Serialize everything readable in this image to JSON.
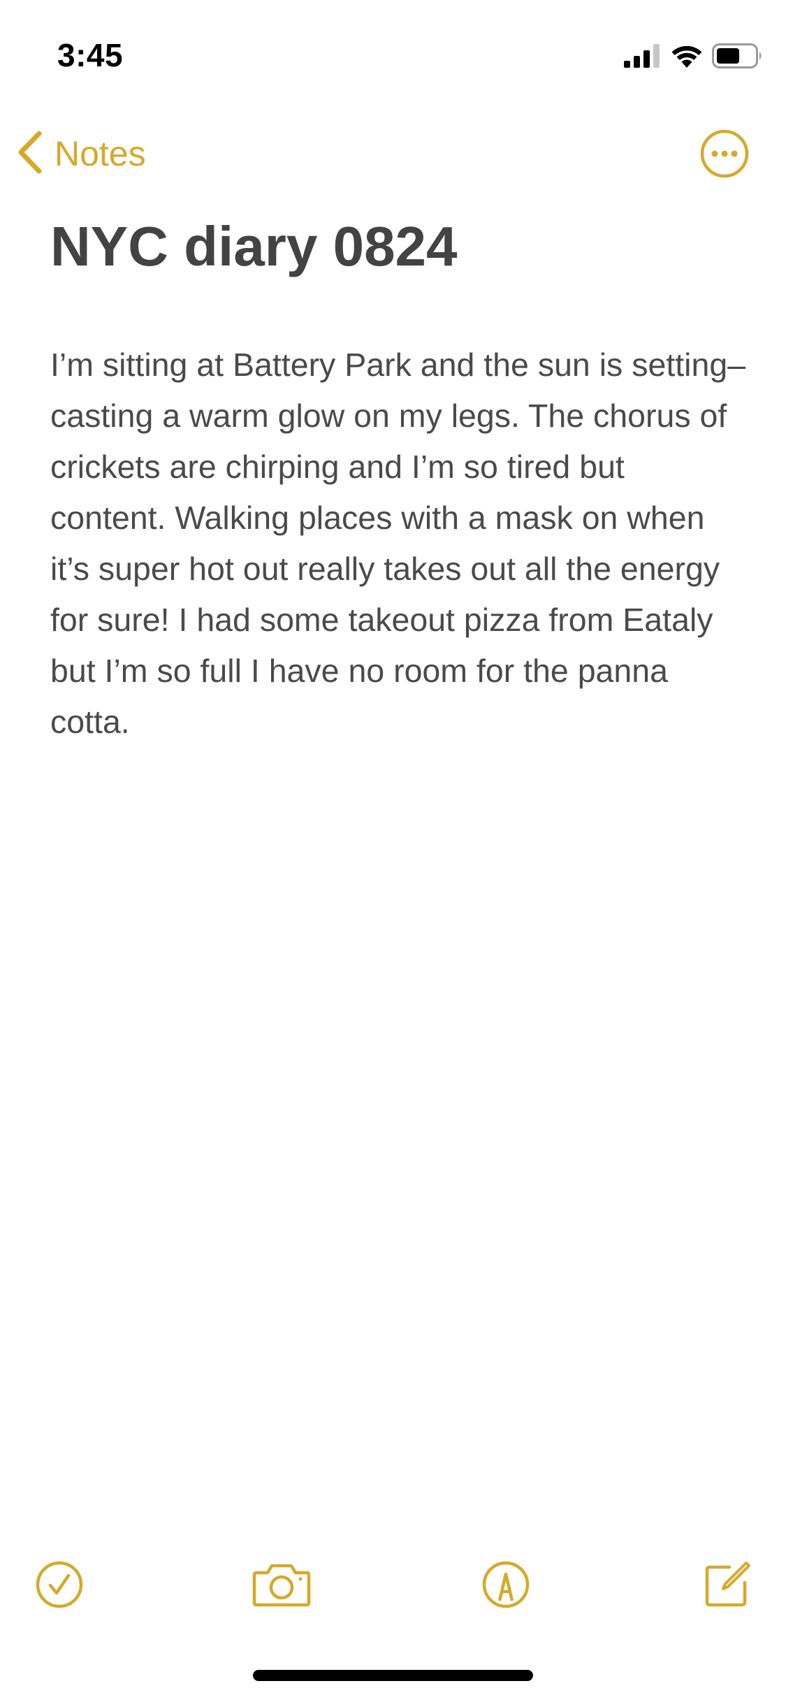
{
  "theme": {
    "accent": "#D6A929",
    "text": "#434343",
    "background": "#FFFFFF"
  },
  "status_bar": {
    "time": "3:45",
    "icons": [
      "cellular-signal-icon",
      "wifi-icon",
      "battery-icon"
    ]
  },
  "nav": {
    "back_label": "Notes",
    "back_icon": "chevron-left-icon",
    "more_icon": "ellipsis-circle-icon"
  },
  "note": {
    "title": "NYC diary 0824",
    "body": "I’m sitting at Battery Park and the sun is setting–casting a warm glow on my legs. The chorus of crickets are chirping and I’m so tired but content. Walking places with a mask on when it’s super hot out really takes out all the energy for sure! I had some takeout pizza from Eataly but I’m so full I have no room for the panna cotta."
  },
  "toolbar": {
    "items": [
      "checklist-icon",
      "camera-icon",
      "markup-icon",
      "compose-icon"
    ]
  }
}
